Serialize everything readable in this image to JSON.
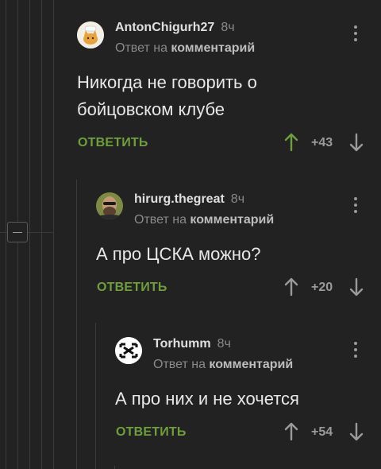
{
  "comments": [
    {
      "author": "AntonChigurh27",
      "time": "8ч",
      "reply_prefix": "Ответ на",
      "reply_target": "комментарий",
      "text_lines": [
        "Никогда не говорить о",
        "бойцовском клубе"
      ],
      "reply_label": "ОТВЕТИТЬ",
      "rating": "+43",
      "upvoted": true,
      "avatar_icon": "chef-cat-avatar"
    },
    {
      "author": "hirurg.thegreat",
      "time": "8ч",
      "reply_prefix": "Ответ на",
      "reply_target": "комментарий",
      "text_lines": [
        "А про ЦСКА можно?"
      ],
      "reply_label": "ОТВЕТИТЬ",
      "rating": "+20",
      "upvoted": false,
      "avatar_icon": "bearded-man-avatar"
    },
    {
      "author": "Torhumm",
      "time": "8ч",
      "reply_prefix": "Ответ на",
      "reply_target": "комментарий",
      "text_lines": [
        "А про них и не хочется"
      ],
      "reply_label": "ОТВЕТИТЬ",
      "rating": "+54",
      "upvoted": false,
      "avatar_icon": "rammstein-logo-avatar"
    }
  ],
  "colors": {
    "background": "#222222",
    "accent_green": "#6e9f3c",
    "muted": "#8a8a8a",
    "thread_line": "#3a3a3a"
  }
}
